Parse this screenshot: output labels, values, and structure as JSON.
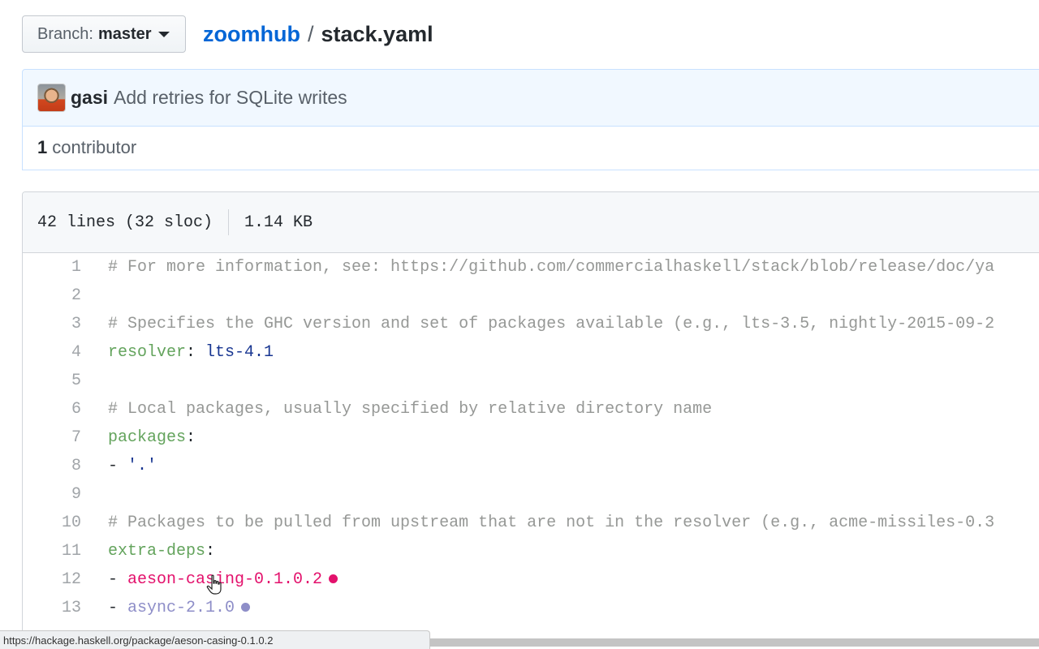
{
  "branch": {
    "prefix": "Branch:",
    "name": "master"
  },
  "breadcrumb": {
    "repo": "zoomhub",
    "separator": "/",
    "file": "stack.yaml"
  },
  "commit": {
    "author": "gasi",
    "message": "Add retries for SQLite writes"
  },
  "contributors": {
    "count": "1",
    "label": "contributor"
  },
  "file_info": {
    "lines": "42 lines (32 sloc)",
    "size": "1.14 KB"
  },
  "code_lines": [
    {
      "num": "1",
      "comment": "# For more information, see: https://github.com/commercialhaskell/stack/blob/release/doc/ya"
    },
    {
      "num": "2"
    },
    {
      "num": "3",
      "comment": "# Specifies the GHC version and set of packages available (e.g., lts-3.5, nightly-2015-09-2"
    },
    {
      "num": "4",
      "key": "resolver",
      "colon": ": ",
      "value": "lts-4.1"
    },
    {
      "num": "5"
    },
    {
      "num": "6",
      "comment": "# Local packages, usually specified by relative directory name"
    },
    {
      "num": "7",
      "key": "packages",
      "colon": ":"
    },
    {
      "num": "8",
      "dash": "- ",
      "value": "'.'"
    },
    {
      "num": "9"
    },
    {
      "num": "10",
      "comment": "# Packages to be pulled from upstream that are not in the resolver (e.g., acme-missiles-0.3"
    },
    {
      "num": "11",
      "key": "extra-deps",
      "colon": ":"
    },
    {
      "num": "12",
      "dash": "- ",
      "link": "aeson-casing-0.1.0.2",
      "link_color": "#e3116c"
    },
    {
      "num": "13",
      "dash": "- ",
      "link": "async-2.1.0",
      "link_color": "#8e8ec8"
    }
  ],
  "status_bar": {
    "url": "https://hackage.haskell.org/package/aeson-casing-0.1.0.2"
  },
  "colors": {
    "accent": "#0366d6",
    "comment": "#969896",
    "key": "#63a35c",
    "string": "#183691"
  }
}
